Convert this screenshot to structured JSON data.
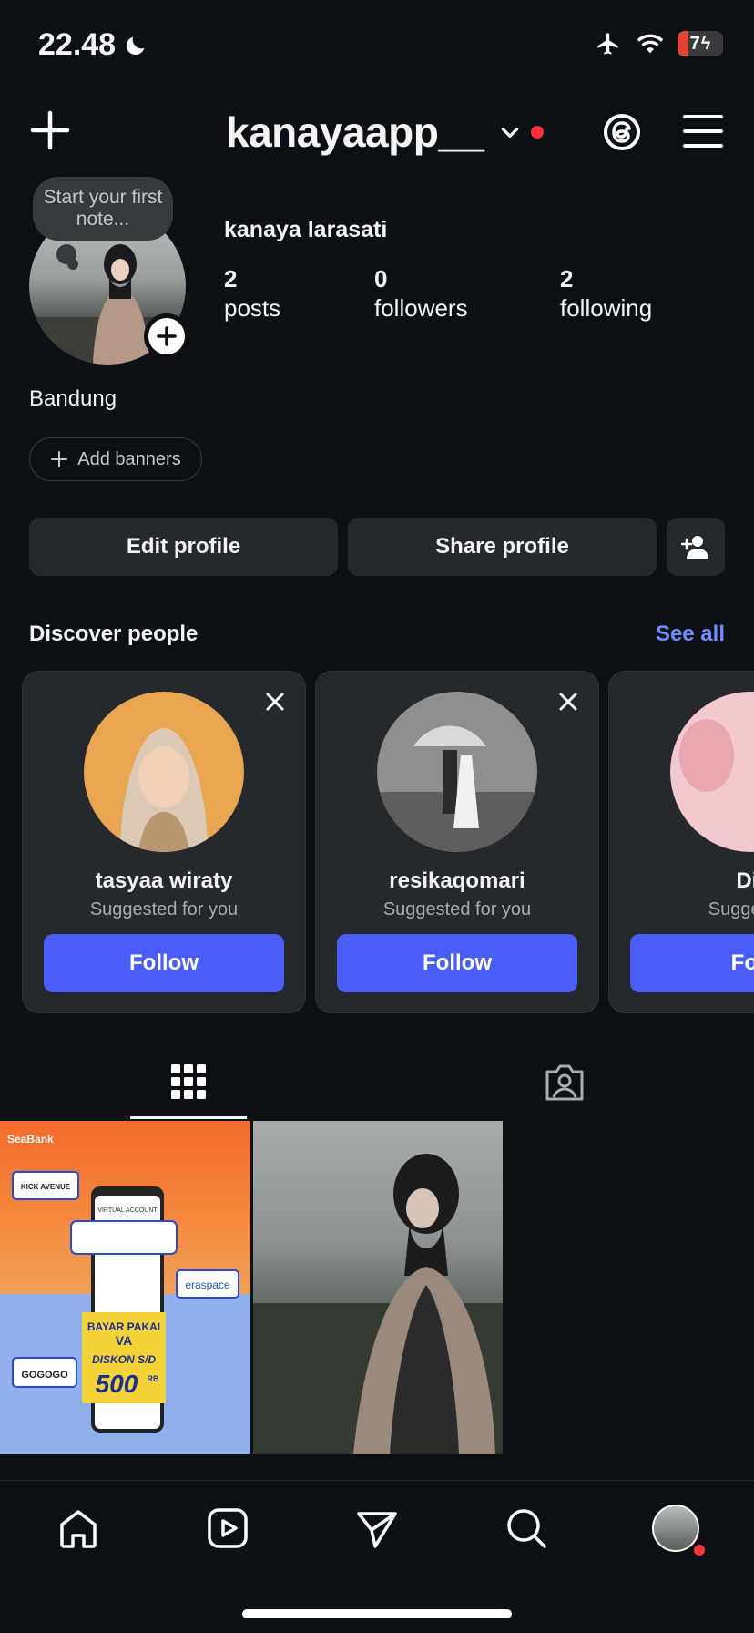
{
  "status_bar": {
    "time": "22.48",
    "battery": "7"
  },
  "header": {
    "username": "kanayaapp__",
    "icons": [
      "plus-icon",
      "chevron-down-icon",
      "threads-icon",
      "menu-icon"
    ]
  },
  "note": {
    "text": "Start your first note..."
  },
  "profile": {
    "full_name": "kanaya larasati",
    "posts_count": "2",
    "posts_label": "posts",
    "followers_count": "0",
    "followers_label": "followers",
    "following_count": "2",
    "following_label": "following",
    "bio": "Bandung",
    "add_banners": "Add banners"
  },
  "actions": {
    "edit": "Edit profile",
    "share": "Share profile"
  },
  "discover": {
    "title": "Discover people",
    "see_all": "See all",
    "people": [
      {
        "name": "tasyaa wiraty",
        "sub": "Suggested for you",
        "button": "Follow"
      },
      {
        "name": "resikaqomari",
        "sub": "Suggested for you",
        "button": "Follow"
      },
      {
        "name": "Dir",
        "sub": "Suggestec",
        "button": "Foll"
      }
    ]
  },
  "post1": {
    "brand": "SeaBank",
    "kick": "KICK AVENUE",
    "va": "VIRTUAL ACCOUNT",
    "eraspace": "eraspace",
    "bayar1": "BAYAR PAKAI",
    "bayar2": "VA",
    "diskon": "DISKON S/D",
    "amount": "500",
    "rb": "RB",
    "gogogo": "GOGOGO"
  },
  "colors": {
    "accent": "#4a5df9",
    "link": "#708dff",
    "notification": "#ff3040",
    "background": "#0c1014"
  }
}
